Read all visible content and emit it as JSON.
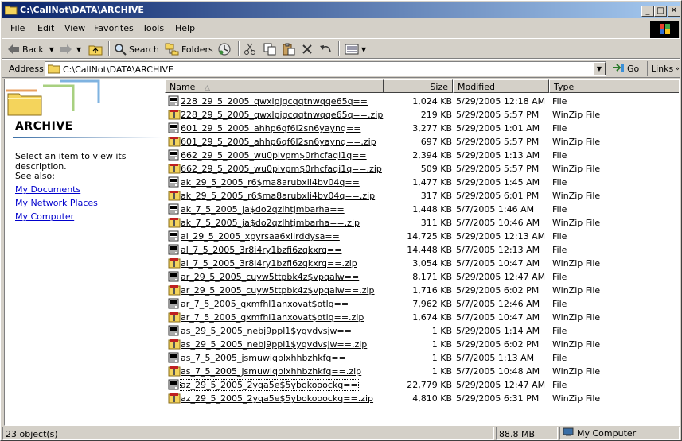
{
  "window": {
    "title": "C:\\CallNot\\DATA\\ARCHIVE",
    "minimize": "_",
    "maximize": "□",
    "close": "✕"
  },
  "menu": [
    "File",
    "Edit",
    "View",
    "Favorites",
    "Tools",
    "Help"
  ],
  "toolbar": {
    "back_label": "Back",
    "search_label": "Search",
    "folders_label": "Folders"
  },
  "address": {
    "label": "Address",
    "value": "C:\\CallNot\\DATA\\ARCHIVE",
    "go_label": "Go",
    "links_label": "Links"
  },
  "left_pane": {
    "folder_title": "ARCHIVE",
    "description": "Select an item to view its description.",
    "see_also": "See also:",
    "links": [
      "My Documents",
      "My Network Places",
      "My Computer"
    ]
  },
  "columns": {
    "name": "Name",
    "size": "Size",
    "modified": "Modified",
    "type": "Type"
  },
  "files": [
    {
      "name": "228_29_5_2005_qwxlpjgcqqtnwqqe65q==",
      "size": "1,024 KB",
      "modified": "5/29/2005 12:18 AM",
      "type": "File",
      "icon": "file-icon"
    },
    {
      "name": "228_29_5_2005_qwxlpjgcqqtnwqqe65q==.zip",
      "size": "219 KB",
      "modified": "5/29/2005 5:57 PM",
      "type": "WinZip File",
      "icon": "winzip-icon"
    },
    {
      "name": "601_29_5_2005_ahhp6qf6l2sn6yaynq==",
      "size": "3,277 KB",
      "modified": "5/29/2005 1:01 AM",
      "type": "File",
      "icon": "file-icon"
    },
    {
      "name": "601_29_5_2005_ahhp6qf6l2sn6yaynq==.zip",
      "size": "697 KB",
      "modified": "5/29/2005 5:57 PM",
      "type": "WinZip File",
      "icon": "winzip-icon"
    },
    {
      "name": "662_29_5_2005_wu0pivpm$0rhcfaqi1q==",
      "size": "2,394 KB",
      "modified": "5/29/2005 1:13 AM",
      "type": "File",
      "icon": "file-icon"
    },
    {
      "name": "662_29_5_2005_wu0pivpm$0rhcfaqi1q==.zip",
      "size": "509 KB",
      "modified": "5/29/2005 5:57 PM",
      "type": "WinZip File",
      "icon": "winzip-icon"
    },
    {
      "name": "ak_29_5_2005_r6$ma8arubxli4bv04q==",
      "size": "1,477 KB",
      "modified": "5/29/2005 1:45 AM",
      "type": "File",
      "icon": "file-icon"
    },
    {
      "name": "ak_29_5_2005_r6$ma8arubxli4bv04q==.zip",
      "size": "317 KB",
      "modified": "5/29/2005 6:01 PM",
      "type": "WinZip File",
      "icon": "winzip-icon"
    },
    {
      "name": "ak_7_5_2005_ja$do2qzlhtjmbarha==",
      "size": "1,448 KB",
      "modified": "5/7/2005 1:46 AM",
      "type": "File",
      "icon": "file-icon"
    },
    {
      "name": "ak_7_5_2005_ja$do2qzlhtjmbarha==.zip",
      "size": "311 KB",
      "modified": "5/7/2005 10:46 AM",
      "type": "WinZip File",
      "icon": "winzip-icon"
    },
    {
      "name": "al_29_5_2005_xpyrsaa6xilrddysa==",
      "size": "14,725 KB",
      "modified": "5/29/2005 12:13 AM",
      "type": "File",
      "icon": "file-icon"
    },
    {
      "name": "al_7_5_2005_3r8i4ry1bzfi6zqkxrq==",
      "size": "14,448 KB",
      "modified": "5/7/2005 12:13 AM",
      "type": "File",
      "icon": "file-icon"
    },
    {
      "name": "al_7_5_2005_3r8i4ry1bzfi6zqkxrq==.zip",
      "size": "3,054 KB",
      "modified": "5/7/2005 10:47 AM",
      "type": "WinZip File",
      "icon": "winzip-icon"
    },
    {
      "name": "ar_29_5_2005_cuyw5ttpbk4z$vpqalw==",
      "size": "8,171 KB",
      "modified": "5/29/2005 12:47 AM",
      "type": "File",
      "icon": "file-icon"
    },
    {
      "name": "ar_29_5_2005_cuyw5ttpbk4z$vpqalw==.zip",
      "size": "1,716 KB",
      "modified": "5/29/2005 6:02 PM",
      "type": "WinZip File",
      "icon": "winzip-icon"
    },
    {
      "name": "ar_7_5_2005_qxmfhl1anxovat$otlq==",
      "size": "7,962 KB",
      "modified": "5/7/2005 12:46 AM",
      "type": "File",
      "icon": "file-icon"
    },
    {
      "name": "ar_7_5_2005_qxmfhl1anxovat$otlq==.zip",
      "size": "1,674 KB",
      "modified": "5/7/2005 10:47 AM",
      "type": "WinZip File",
      "icon": "winzip-icon"
    },
    {
      "name": "as_29_5_2005_nebj9ppl1$yqvdvsjw==",
      "size": "1 KB",
      "modified": "5/29/2005 1:14 AM",
      "type": "File",
      "icon": "file-icon"
    },
    {
      "name": "as_29_5_2005_nebj9ppl1$yqvdvsjw==.zip",
      "size": "1 KB",
      "modified": "5/29/2005 6:02 PM",
      "type": "WinZip File",
      "icon": "winzip-icon"
    },
    {
      "name": "as_7_5_2005_jsmuwiqblxhhbzhkfq==",
      "size": "1 KB",
      "modified": "5/7/2005 1:13 AM",
      "type": "File",
      "icon": "file-icon"
    },
    {
      "name": "as_7_5_2005_jsmuwiqblxhhbzhkfq==.zip",
      "size": "1 KB",
      "modified": "5/7/2005 10:48 AM",
      "type": "WinZip File",
      "icon": "winzip-icon"
    },
    {
      "name": "az_29_5_2005_2yqa5e$5ybokooockq==",
      "size": "22,779 KB",
      "modified": "5/29/2005 12:47 AM",
      "type": "File",
      "icon": "file-icon"
    },
    {
      "name": "az_29_5_2005_2yqa5e$5ybokooockq==.zip",
      "size": "4,810 KB",
      "modified": "5/29/2005 6:31 PM",
      "type": "WinZip File",
      "icon": "winzip-icon"
    }
  ],
  "status": {
    "objects": "23 object(s)",
    "size": "88.8 MB",
    "location": "My Computer"
  }
}
